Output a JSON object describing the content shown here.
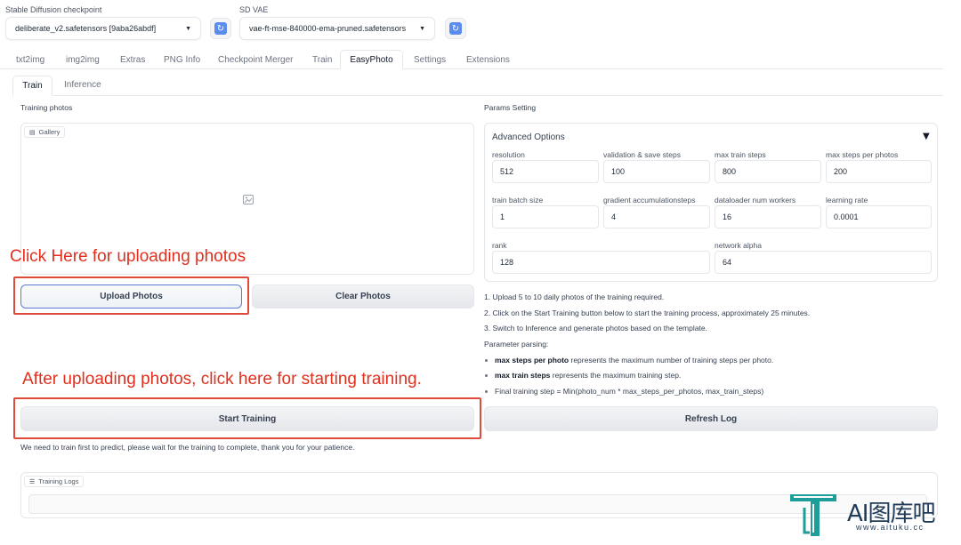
{
  "header": {
    "checkpoint_label": "Stable Diffusion checkpoint",
    "checkpoint_value": "deliberate_v2.safetensors [9aba26abdf]",
    "vae_label": "SD VAE",
    "vae_value": "vae-ft-mse-840000-ema-pruned.safetensors"
  },
  "tabs": [
    "txt2img",
    "img2img",
    "Extras",
    "PNG Info",
    "Checkpoint Merger",
    "Train",
    "EasyPhoto",
    "Settings",
    "Extensions"
  ],
  "active_tab": "EasyPhoto",
  "subtabs": [
    "Train",
    "Inference"
  ],
  "left": {
    "training_photos_label": "Training photos",
    "gallery_label": "Gallery",
    "upload_button": "Upload Photos",
    "clear_button": "Clear Photos",
    "start_button": "Start Training",
    "note": "We need to train first to predict, please wait for the training to complete, thank you for your patience.",
    "logs_label": "Training Logs"
  },
  "right": {
    "params_label": "Params Setting",
    "advanced_label": "Advanced Options",
    "collapse_glyph": "▼",
    "params": [
      {
        "label": "resolution",
        "value": "512"
      },
      {
        "label": "validation & save steps",
        "value": "100"
      },
      {
        "label": "max train steps",
        "value": "800"
      },
      {
        "label": "max steps per photos",
        "value": "200"
      },
      {
        "label": "train batch size",
        "value": "1"
      },
      {
        "label": "gradient accumulationsteps",
        "value": "4"
      },
      {
        "label": "dataloader num workers",
        "value": "16"
      },
      {
        "label": "learning rate",
        "value": "0.0001"
      },
      {
        "label": "rank",
        "value": "128"
      },
      {
        "label": "network alpha",
        "value": "64"
      }
    ],
    "instructions": [
      "1. Upload 5 to 10 daily photos of the training required.",
      "2. Click on the Start Training button below to start the training process, approximately 25 minutes.",
      "3. Switch to Inference and generate photos based on the template."
    ],
    "parsing_label": "Parameter parsing:",
    "bullets": [
      {
        "bold": "max steps per photo",
        "rest": " represents the maximum number of training steps per photo."
      },
      {
        "bold": "max train steps",
        "rest": " represents the maximum training step."
      },
      {
        "bold": "",
        "rest": "Final training step = Min(photo_num * max_steps_per_photos, max_train_steps)"
      }
    ],
    "refresh_button": "Refresh Log"
  },
  "annotations": {
    "upload_hint": "Click Here for uploading photos",
    "start_hint": "After uploading photos, click here for starting training."
  },
  "watermark": {
    "brand": "AI图库吧",
    "url": "www.aituku.cc"
  }
}
